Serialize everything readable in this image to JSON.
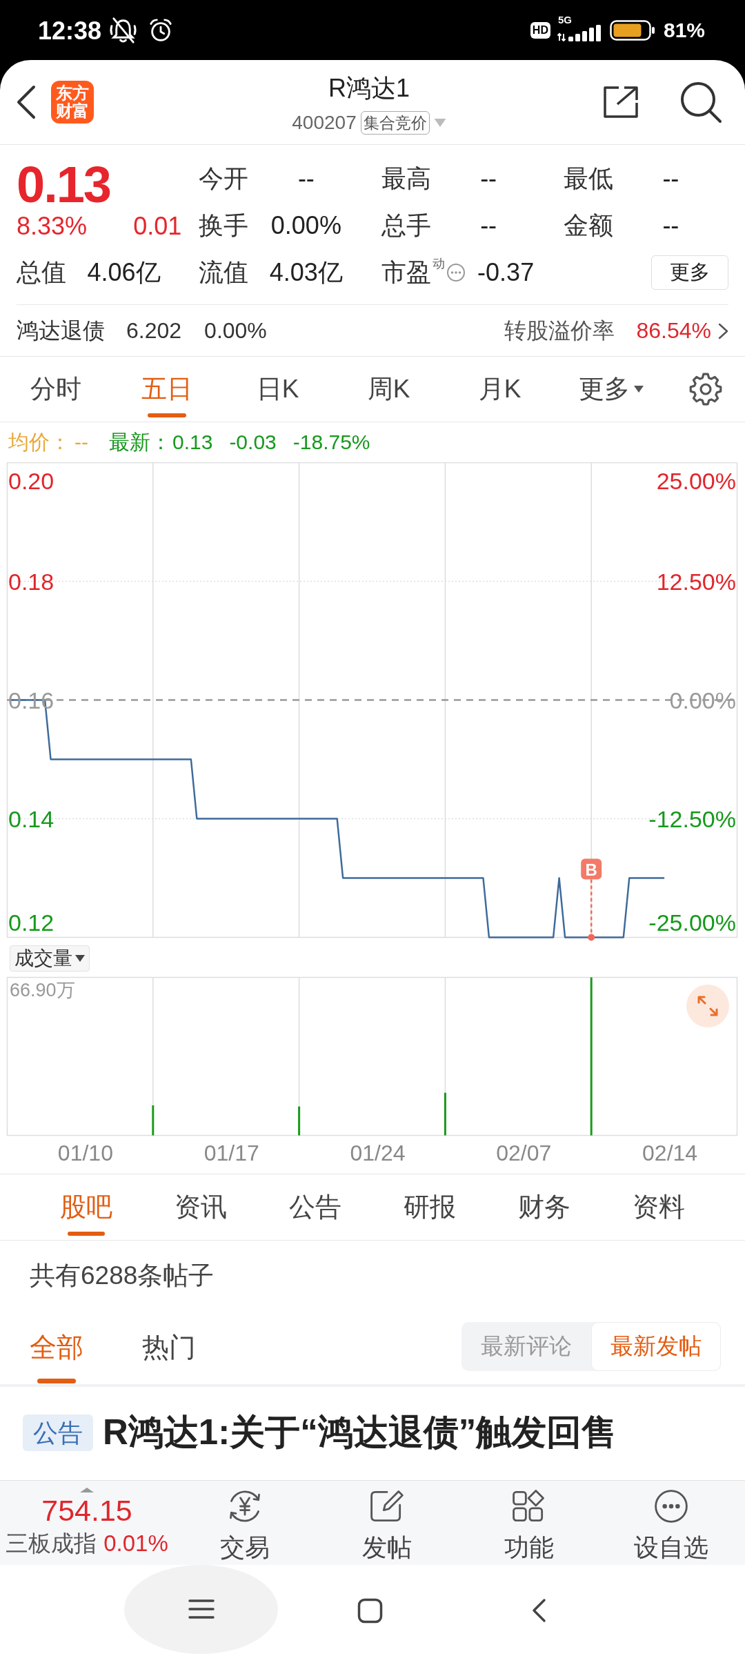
{
  "status_bar": {
    "time": "12:38",
    "hd": "HD",
    "network": "5G",
    "battery": "81%"
  },
  "header": {
    "logo": "东方财富",
    "title": "R鸿达1",
    "code": "400207",
    "badge": "集合竞价"
  },
  "quote": {
    "price": "0.13",
    "change_pct": "8.33%",
    "change": "0.01",
    "fields": [
      {
        "label": "今开",
        "value": "--"
      },
      {
        "label": "最高",
        "value": "--"
      },
      {
        "label": "最低",
        "value": "--"
      },
      {
        "label": "换手",
        "value": "0.00%"
      },
      {
        "label": "总手",
        "value": "--"
      },
      {
        "label": "金额",
        "value": "--"
      },
      {
        "label": "总值",
        "value": "4.06亿"
      },
      {
        "label": "流值",
        "value": "4.03亿"
      },
      {
        "label": "市盈$^{动}$",
        "value": "-0.37",
        "info": true
      }
    ],
    "more_button": "更多"
  },
  "bond": {
    "name": "鸿达退债",
    "price": "6.202",
    "change": "0.00%",
    "premium_label": "转股溢价率",
    "premium": "86.54%"
  },
  "chart_tabs": [
    {
      "label": "分时",
      "selected": false,
      "dropdown": false
    },
    {
      "label": "五日",
      "selected": true,
      "dropdown": false
    },
    {
      "label": "日K",
      "selected": false,
      "dropdown": false
    },
    {
      "label": "周K",
      "selected": false,
      "dropdown": false
    },
    {
      "label": "月K",
      "selected": false,
      "dropdown": false
    },
    {
      "label": "更多",
      "selected": false,
      "dropdown": true
    }
  ],
  "summary": {
    "avg_label": "均价：",
    "avg_value": "--",
    "latest_label": "最新：",
    "latest_value": "0.13",
    "change": "-0.03",
    "change_pct": "-18.75%"
  },
  "chart": {
    "chart_data": {
      "type": "line",
      "categories": [
        null,
        null,
        null,
        null,
        null,
        null,
        null,
        null,
        null,
        null,
        null,
        null,
        null,
        null,
        null,
        null,
        null,
        null,
        null,
        null,
        null,
        null,
        null,
        null,
        null,
        null,
        null,
        null,
        null,
        null,
        null,
        null,
        null,
        null,
        null,
        null,
        null,
        null,
        null,
        null,
        null,
        null,
        null,
        null,
        null,
        null,
        null,
        null,
        null,
        null,
        null,
        null,
        null,
        null,
        null,
        null,
        null,
        null,
        null,
        null,
        null,
        null,
        null,
        null,
        null,
        null,
        null,
        null,
        null,
        null,
        null,
        null,
        null,
        null,
        null,
        null,
        null,
        null,
        null,
        null,
        null,
        null,
        null,
        null,
        null,
        null,
        null,
        null,
        null,
        null,
        null,
        null,
        null,
        null,
        null,
        null,
        null,
        null,
        null,
        null,
        null,
        null,
        null,
        null,
        null,
        null,
        null,
        null,
        null,
        null,
        null,
        null,
        null
      ],
      "series": [
        {
          "color": "#3e6a9a",
          "values": [
            0.16,
            0.16,
            0.16,
            0.16,
            0.16,
            0.16,
            0.16,
            0.15,
            0.15,
            0.15,
            0.15,
            0.15,
            0.15,
            0.15,
            0.15,
            0.15,
            0.15,
            0.15,
            0.15,
            0.15,
            0.15,
            0.15,
            0.15,
            0.15,
            0.15,
            0.15,
            0.15,
            0.15,
            0.15,
            0.15,
            0.15,
            0.15,
            0.14,
            0.14,
            0.14,
            0.14,
            0.14,
            0.14,
            0.14,
            0.14,
            0.14,
            0.14,
            0.14,
            0.14,
            0.14,
            0.14,
            0.14,
            0.14,
            0.14,
            0.14,
            0.14,
            0.14,
            0.14,
            0.14,
            0.14,
            0.14,
            0.14,
            0.13,
            0.13,
            0.13,
            0.13,
            0.13,
            0.13,
            0.13,
            0.13,
            0.13,
            0.13,
            0.13,
            0.13,
            0.13,
            0.13,
            0.13,
            0.13,
            0.13,
            0.13,
            0.13,
            0.13,
            0.13,
            0.13,
            0.13,
            0.13,
            0.13,
            0.12,
            0.12,
            0.12,
            0.12,
            0.12,
            0.12,
            0.12,
            0.12,
            0.12,
            0.12,
            0.12,
            0.12,
            0.13,
            0.12,
            0.12,
            0.12,
            0.12,
            0.12,
            0.12,
            0.12,
            0.12,
            0.12,
            0.12,
            0.12,
            0.13,
            0.13,
            0.13,
            0.13,
            0.13,
            0.13,
            0.13
          ]
        }
      ],
      "ylim": [
        0.12,
        0.2
      ],
      "yticks": [
        {
          "value": 0.2,
          "label": "0.20"
        },
        {
          "value": 0.18,
          "label": "0.18"
        },
        {
          "value": 0.16,
          "label": "0.16"
        },
        {
          "value": 0.14,
          "label": "0.14"
        },
        {
          "value": 0.12,
          "label": "0.12"
        }
      ],
      "ref_lines": [
        {
          "axis": "y",
          "value": 0.16
        }
      ],
      "annotations": [
        {
          "text": "B"
        }
      ]
    },
    "percent_ticks": [
      "25.00%",
      "12.50%",
      "0.00%",
      "-12.50%",
      "-25.00%"
    ]
  },
  "volume": {
    "selector": "成交量",
    "max_label": "66.90万",
    "date_labels": [
      "01/10",
      "01/17",
      "01/24",
      "02/07",
      "02/14"
    ]
  },
  "news_tabs": [
    {
      "label": "股吧",
      "selected": true
    },
    {
      "label": "资讯",
      "selected": false
    },
    {
      "label": "公告",
      "selected": false
    },
    {
      "label": "研报",
      "selected": false
    },
    {
      "label": "财务",
      "selected": false
    },
    {
      "label": "资料",
      "selected": false
    }
  ],
  "post_count": "共有6288条帖子",
  "post_filters": [
    {
      "label": "全部",
      "selected": true
    },
    {
      "label": "热门",
      "selected": false
    }
  ],
  "sort_options": [
    {
      "label": "最新评论",
      "selected": false
    },
    {
      "label": "最新发帖",
      "selected": true
    }
  ],
  "posts": [
    {
      "tag": "公告",
      "title": "R鸿达1:关于“鸿达退债”触发回售"
    }
  ],
  "bottom_bar": {
    "index_value": "754.15",
    "index_name": "三板成指",
    "index_change": "0.01%",
    "actions": [
      {
        "kind": "trade",
        "label": "交易"
      },
      {
        "kind": "post",
        "label": "发帖"
      },
      {
        "kind": "apps",
        "label": "功能"
      },
      {
        "kind": "watchlist",
        "label": "设自选"
      }
    ]
  }
}
